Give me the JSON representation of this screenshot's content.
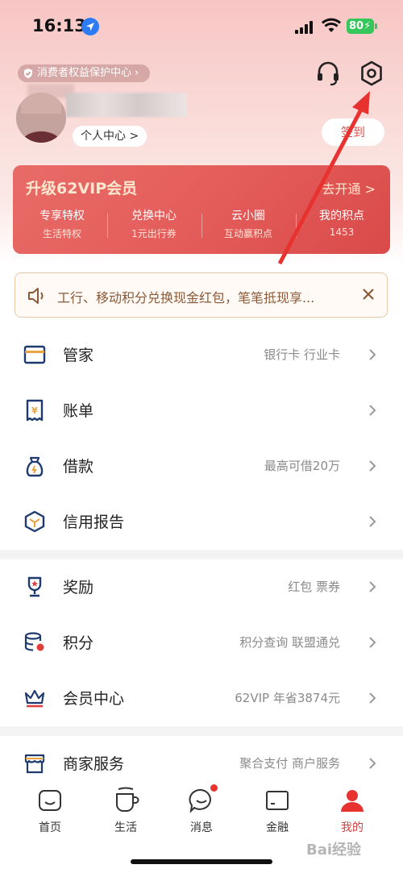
{
  "status_bar": {
    "time": "16:13",
    "battery": "80"
  },
  "header": {
    "consumer_protection": "消费者权益保护中心",
    "personal_center": "个人中心 >",
    "checkin": "签到"
  },
  "vip_card": {
    "title": "升级62VIP会员",
    "open": "去开通 >",
    "items": [
      {
        "title": "专享特权",
        "sub": "生活特权"
      },
      {
        "title": "兑换中心",
        "sub": "1元出行券"
      },
      {
        "title": "云小圈",
        "sub": "互动赢积点"
      },
      {
        "title": "我的积点",
        "sub": "1453"
      }
    ]
  },
  "notice": {
    "text": "工行、移动积分兑换现金红包，笔笔抵现享..."
  },
  "menu": [
    {
      "label": "管家",
      "hint": "银行卡 行业卡",
      "icon": "card-icon"
    },
    {
      "label": "账单",
      "hint": "",
      "icon": "bill-icon"
    },
    {
      "label": "借款",
      "hint": "最高可借20万",
      "icon": "loan-bag-icon"
    },
    {
      "label": "信用报告",
      "hint": "",
      "icon": "credit-cube-icon"
    },
    {
      "label": "奖励",
      "hint": "红包 票券",
      "icon": "trophy-icon"
    },
    {
      "label": "积分",
      "hint": "积分查询 联盟通兑",
      "icon": "coins-icon"
    },
    {
      "label": "会员中心",
      "hint": "62VIP 年省3874元",
      "icon": "crown-icon"
    },
    {
      "label": "商家服务",
      "hint": "聚合支付 商户服务",
      "icon": "shop-icon"
    }
  ],
  "tabbar": [
    {
      "label": "首页",
      "icon": "home-icon"
    },
    {
      "label": "生活",
      "icon": "cup-icon"
    },
    {
      "label": "消息",
      "icon": "message-icon"
    },
    {
      "label": "金融",
      "icon": "finance-card-icon"
    },
    {
      "label": "我的",
      "icon": "profile-icon"
    }
  ],
  "watermark": "Bai经验",
  "colors": {
    "accent": "#e8322f",
    "vip": "#e45d5b",
    "notice_text": "#8a5a38"
  }
}
